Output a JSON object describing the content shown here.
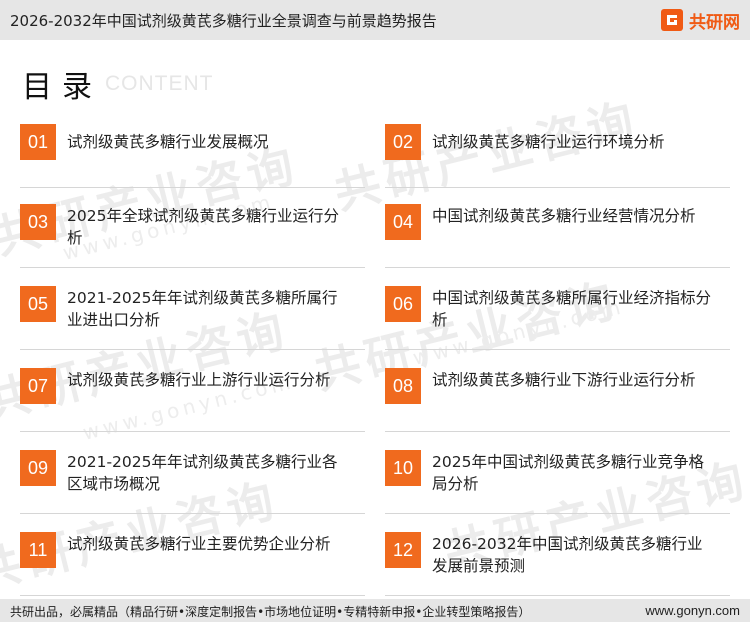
{
  "header": {
    "title": "2026-2032年中国试剂级黄芪多糖行业全景调查与前景趋势报告",
    "brand_name": "共研网",
    "brand_color": "#f05a14"
  },
  "watermark": {
    "text": "共研产业咨询",
    "url": "www.gonyn.com"
  },
  "toc": {
    "title": "目录",
    "subtitle": "CONTENT",
    "accent_color": "#f06a1e",
    "items": [
      {
        "num": "01",
        "label": "试剂级黄芪多糖行业发展概况"
      },
      {
        "num": "02",
        "label": "试剂级黄芪多糖行业运行环境分析"
      },
      {
        "num": "03",
        "label": "2025年全球试剂级黄芪多糖行业运行分析"
      },
      {
        "num": "04",
        "label": "中国试剂级黄芪多糖行业经营情况分析"
      },
      {
        "num": "05",
        "label": "2021-2025年年试剂级黄芪多糖所属行业进出口分析"
      },
      {
        "num": "06",
        "label": "中国试剂级黄芪多糖所属行业经济指标分析"
      },
      {
        "num": "07",
        "label": "试剂级黄芪多糖行业上游行业运行分析"
      },
      {
        "num": "08",
        "label": "试剂级黄芪多糖行业下游行业运行分析"
      },
      {
        "num": "09",
        "label": "2021-2025年年试剂级黄芪多糖行业各区域市场概况"
      },
      {
        "num": "10",
        "label": "2025年中国试剂级黄芪多糖行业竞争格局分析"
      },
      {
        "num": "11",
        "label": "试剂级黄芪多糖行业主要优势企业分析"
      },
      {
        "num": "12",
        "label": "2026-2032年中国试剂级黄芪多糖行业发展前景预测"
      }
    ]
  },
  "footer": {
    "left": "共研出品，必属精品（精品行研•深度定制报告•市场地位证明•专精特新申报•企业转型策略报告）",
    "right": "www.gonyn.com"
  }
}
